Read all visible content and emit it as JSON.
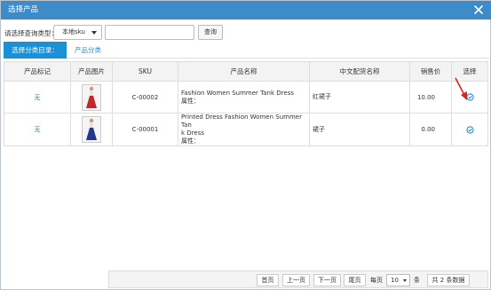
{
  "dialog": {
    "title": "选择产品",
    "close_icon": "close-icon"
  },
  "query": {
    "label": "请选择查询类型：",
    "type_selected": "本地sku",
    "input_value": "",
    "search_button": "查询"
  },
  "tabs": {
    "active": "选择分类目录：",
    "link": "产品分类"
  },
  "table": {
    "headers": [
      "产品标记",
      "产品图片",
      "SKU",
      "产品名称",
      "中文配货名称",
      "销售价",
      "选择"
    ],
    "rows": [
      {
        "mark": "无",
        "image_icon": "dress-red-icon",
        "sku": "C-00002",
        "name_line1": "Fashion Women Summer Tank Dress",
        "name_line2": "属性：",
        "name_line3": "",
        "cn_name": "红裙子",
        "price": "10.00",
        "select_icon": "check-circle-icon"
      },
      {
        "mark": "无",
        "image_icon": "dress-blue-icon",
        "sku": "C-00001",
        "name_line1": "Printed Dress Fashion Women Summer Tan",
        "name_line2": "k Dress",
        "name_line3": "属性：",
        "cn_name": "裙子",
        "price": "0.00",
        "select_icon": "check-circle-icon"
      }
    ]
  },
  "pager": {
    "first": "首页",
    "prev": "上一页",
    "next": "下一页",
    "last": "尾页",
    "per_page_label": "每页",
    "per_page_value": "10",
    "per_page_unit": "条",
    "total": "共 2 条数据"
  },
  "colors": {
    "titlebar": "#3d8bc9",
    "tab_active": "#1a90d6",
    "mark_text": "#3a9d3a",
    "annotation_arrow": "#e02020"
  }
}
